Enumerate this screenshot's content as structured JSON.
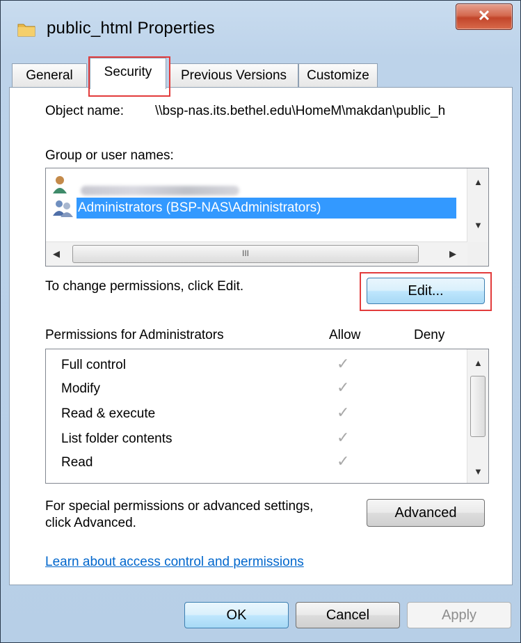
{
  "window": {
    "title": "public_html Properties",
    "close_glyph": "✕",
    "icon": "folder-icon"
  },
  "tabs": [
    {
      "label": "General",
      "active": false
    },
    {
      "label": "Security",
      "active": true
    },
    {
      "label": "Previous Versions",
      "active": false
    },
    {
      "label": "Customize",
      "active": false
    }
  ],
  "security": {
    "object_name_label": "Object name:",
    "object_name_value": "\\\\bsp-nas.its.bethel.edu\\HomeM\\makdan\\public_h",
    "group_label": "Group or user names:",
    "groups": [
      {
        "label": "",
        "icon": "user-icon",
        "blurred": true,
        "selected": false
      },
      {
        "label": "Administrators (BSP-NAS\\Administrators)",
        "icon": "group-icon",
        "blurred": false,
        "selected": true
      }
    ],
    "scroll_thumb_glyph": "III",
    "change_text": "To change permissions, click Edit.",
    "edit_button": "Edit...",
    "perm_header": "Permissions for Administrators",
    "allow_header": "Allow",
    "deny_header": "Deny",
    "permissions": [
      {
        "name": "Full control",
        "allow": true,
        "deny": false
      },
      {
        "name": "Modify",
        "allow": true,
        "deny": false
      },
      {
        "name": "Read & execute",
        "allow": true,
        "deny": false
      },
      {
        "name": "List folder contents",
        "allow": true,
        "deny": false
      },
      {
        "name": "Read",
        "allow": true,
        "deny": false
      }
    ],
    "check_glyph": "✓",
    "special_text_line1": "For special permissions or advanced settings,",
    "special_text_line2": "click Advanced.",
    "advanced_button": "Advanced",
    "learn_link": "Learn about access control and permissions"
  },
  "footer": {
    "ok": "OK",
    "cancel": "Cancel",
    "apply": "Apply"
  },
  "colors": {
    "highlight_box": "#e23b3b",
    "selection": "#3399ff",
    "link": "#0066cc"
  }
}
